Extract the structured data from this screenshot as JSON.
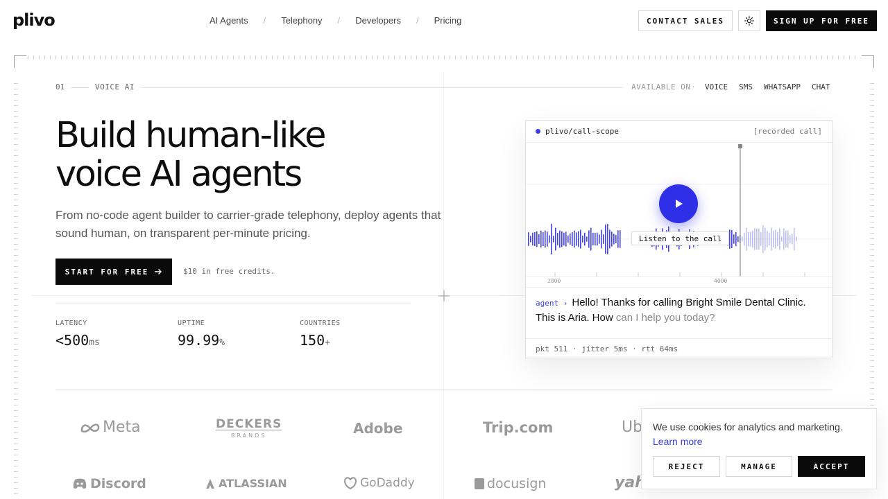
{
  "header": {
    "logo": "plivo",
    "nav": [
      "AI Agents",
      "Telephony",
      "Developers",
      "Pricing"
    ],
    "nav_separator": "/",
    "contact_sales": "CONTACT SALES",
    "signup": "SIGN UP FOR FREE",
    "theme_icon": "sun-icon"
  },
  "section": {
    "number": "01",
    "name": "VOICE AI",
    "available_label": "AVAILABLE ON",
    "dot": "·",
    "channels": [
      "VOICE",
      "SMS",
      "WHATSAPP",
      "CHAT"
    ]
  },
  "hero": {
    "title_line1": "Build human-like",
    "title_line2_a": "voice",
    "title_line2_b": " AI ",
    "title_line2_c": "agents",
    "subtitle": "From no-code agent builder to carrier-grade telephony, deploy agents that sound human, on transparent per-minute pricing.",
    "cta": "START FOR FREE",
    "credits": "$10 in free credits."
  },
  "stats": [
    {
      "label": "LATENCY",
      "value": "<500",
      "unit": "ms"
    },
    {
      "label": "UPTIME",
      "value": "99.99",
      "unit": "%"
    },
    {
      "label": "COUNTRIES",
      "value": "150",
      "unit": "+"
    }
  ],
  "call_scope": {
    "title": "plivo/call-scope",
    "tag": "[recorded call]",
    "listen": "Listen to the call",
    "axis": [
      "2000",
      "4000"
    ],
    "speaker": "agent ›",
    "message_main": "Hello! Thanks for calling Bright Smile Dental Clinic. This is Aria. How",
    "message_faded": " can I help you today?",
    "footer": "pkt 511 · jitter 5ms · rtt 64ms",
    "accent_color": "#2f2fe8"
  },
  "brands_row1": [
    "Meta",
    "DECKERS",
    "BRANDS",
    "Adobe",
    "Trip.com",
    "Ub"
  ],
  "brands_row2": [
    "Discord",
    "ATLASSIAN",
    "GoDaddy",
    "docusign",
    "yah"
  ],
  "cookie": {
    "text": "We use cookies for analytics and marketing.",
    "link": "Learn more",
    "reject": "REJECT",
    "manage": "MANAGE",
    "accept": "ACCEPT"
  }
}
